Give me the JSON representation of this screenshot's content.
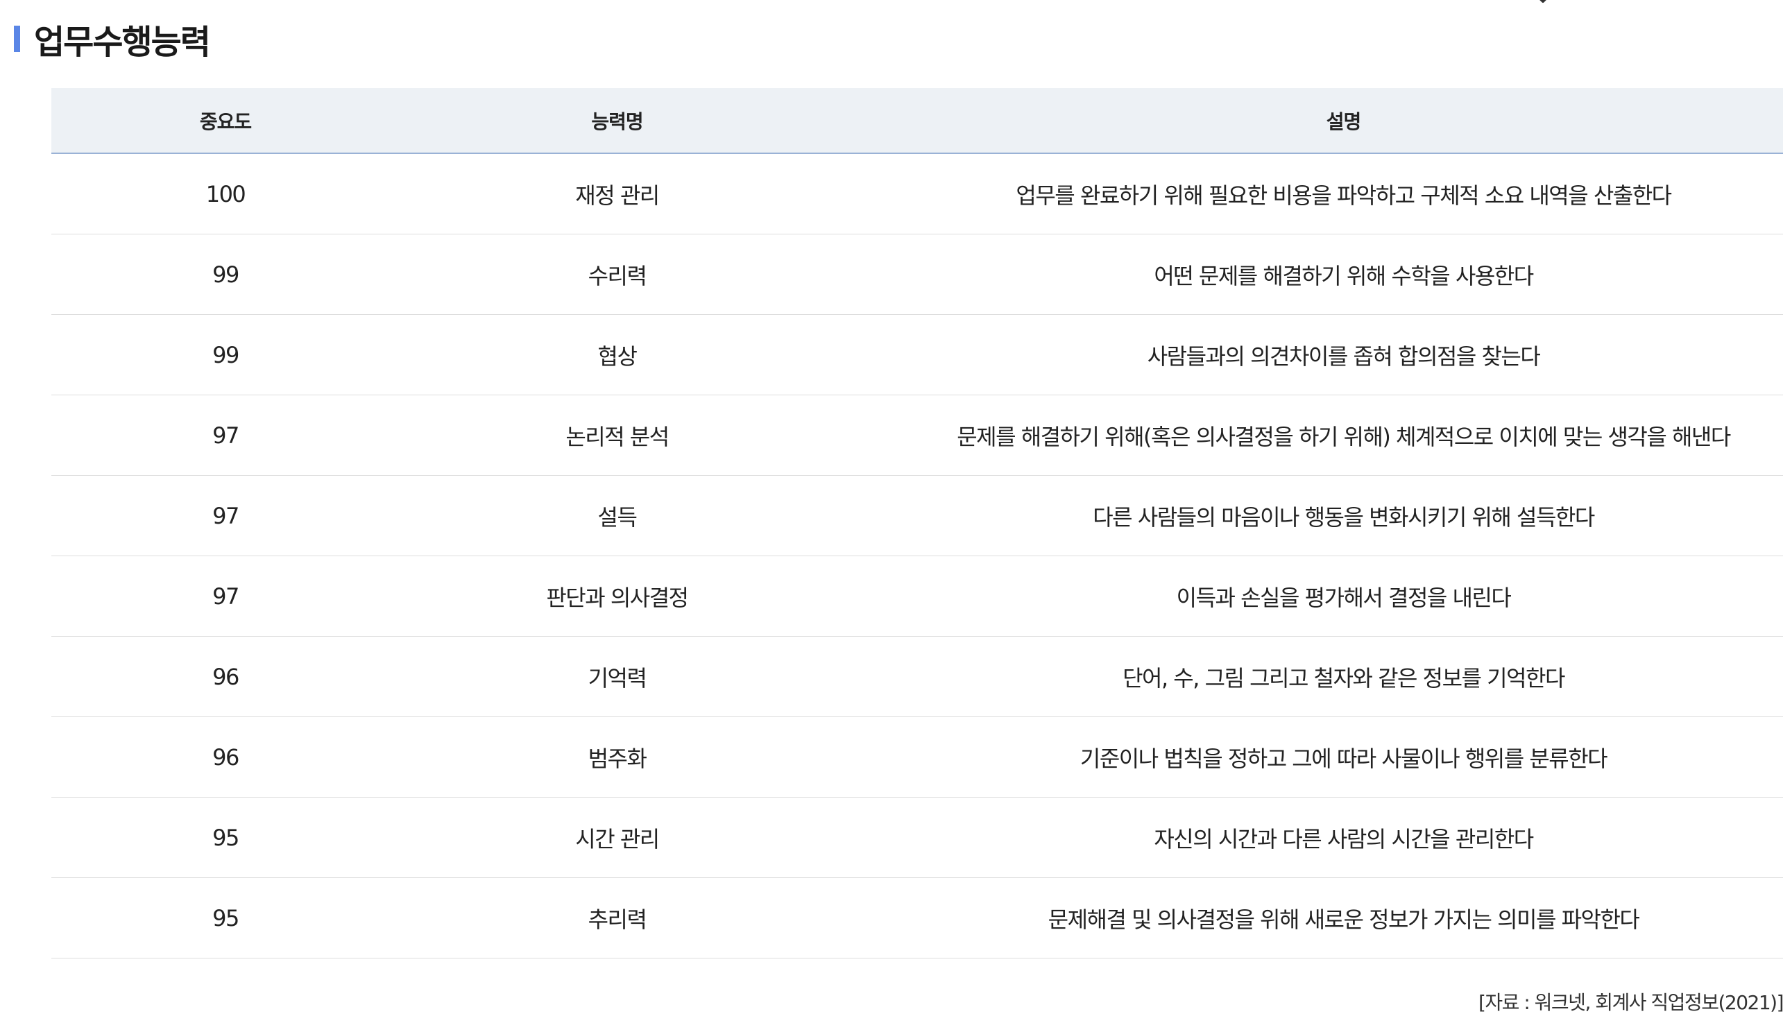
{
  "section": {
    "title": "업무수행능력"
  },
  "table": {
    "headers": [
      "중요도",
      "능력명",
      "설명"
    ],
    "rows": [
      {
        "importance": "100",
        "name": "재정 관리",
        "description": "업무를 완료하기 위해 필요한 비용을 파악하고 구체적 소요 내역을 산출한다"
      },
      {
        "importance": "99",
        "name": "수리력",
        "description": "어떤 문제를 해결하기 위해 수학을 사용한다"
      },
      {
        "importance": "99",
        "name": "협상",
        "description": "사람들과의 의견차이를 좁혀 합의점을 찾는다"
      },
      {
        "importance": "97",
        "name": "논리적 분석",
        "description": "문제를 해결하기 위해(혹은 의사결정을 하기 위해) 체계적으로 이치에 맞는 생각을 해낸다"
      },
      {
        "importance": "97",
        "name": "설득",
        "description": "다른 사람들의 마음이나 행동을 변화시키기 위해 설득한다"
      },
      {
        "importance": "97",
        "name": "판단과 의사결정",
        "description": "이득과 손실을 평가해서 결정을 내린다"
      },
      {
        "importance": "96",
        "name": "기억력",
        "description": "단어, 수, 그림 그리고 철자와 같은 정보를 기억한다"
      },
      {
        "importance": "96",
        "name": "범주화",
        "description": "기준이나 법칙을 정하고 그에 따라 사물이나 행위를 분류한다"
      },
      {
        "importance": "95",
        "name": "시간 관리",
        "description": "자신의 시간과 다른 사람의 시간을 관리한다"
      },
      {
        "importance": "95",
        "name": "추리력",
        "description": "문제해결 및 의사결정을 위해 새로운 정보가 가지는 의미를 파악한다"
      }
    ]
  },
  "source": "[자료 : 워크넷, 회계사 직업정보(2021)]",
  "colors": {
    "accent": "#5a86e6",
    "header_bg": "#edf1f5",
    "header_border": "#9ab2d6",
    "row_border": "#dddddd"
  },
  "icons": {
    "top_chevron": "chevron-down-icon"
  }
}
